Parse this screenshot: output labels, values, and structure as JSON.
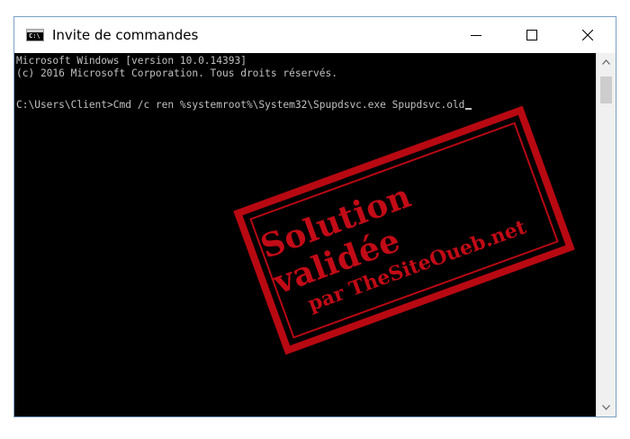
{
  "window": {
    "title": "Invite de commandes",
    "app_icon_glyph": "C:\\"
  },
  "caption_buttons": {
    "minimize": "minimize-icon",
    "maximize": "maximize-icon",
    "close": "close-icon"
  },
  "console": {
    "lines": [
      "Microsoft Windows [version 10.0.14393]",
      "(c) 2016 Microsoft Corporation. Tous droits réservés.",
      "",
      "C:\\Users\\Client>Cmd /c ren %systemroot%\\System32\\Spupdsvc.exe Spupdsvc.old"
    ],
    "text_color": "#c0c0c0",
    "background": "#000000"
  },
  "watermark": {
    "line1": "Solution validée",
    "line2": "par TheSiteOueb.net",
    "color": "#d30c18"
  }
}
